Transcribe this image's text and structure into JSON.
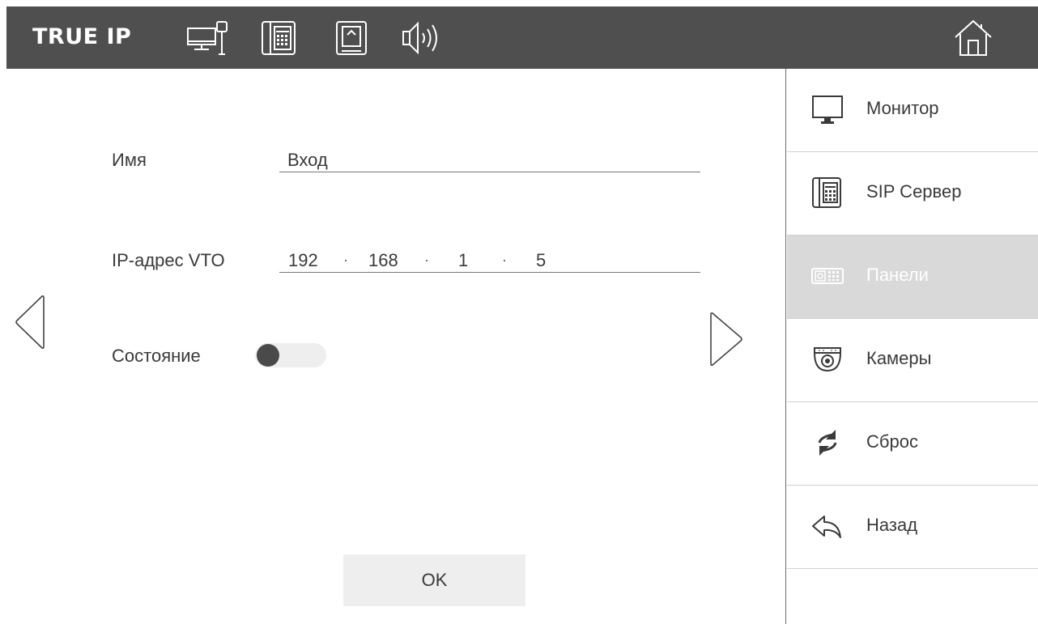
{
  "header": {
    "brand": "TRUE IP",
    "icons": [
      "network-monitor-icon",
      "sip-phone-icon",
      "sd-card-icon",
      "speaker-icon"
    ],
    "home_icon": "home-icon"
  },
  "form": {
    "name_label": "Имя",
    "name_value": "Вход",
    "ip_label": "IP-адрес VTO",
    "ip": {
      "octet1": "192",
      "octet2": "168",
      "octet3": "1",
      "octet4": "5",
      "separator": "·"
    },
    "status_label": "Состояние",
    "status_on": false,
    "ok_label": "OK"
  },
  "sidebar": {
    "items": [
      {
        "label": "Монитор",
        "icon": "monitor-icon"
      },
      {
        "label": "SIP Сервер",
        "icon": "sip-phone-icon"
      },
      {
        "label": "Панели",
        "icon": "door-panel-icon",
        "active": true
      },
      {
        "label": "Камеры",
        "icon": "dome-camera-icon"
      },
      {
        "label": "Сброс",
        "icon": "reset-arrows-icon"
      },
      {
        "label": "Назад",
        "icon": "back-arrow-icon"
      }
    ]
  },
  "colors": {
    "topbar": "#4f4f4f",
    "active_item": "#d9d9d9",
    "button_bg": "#eeeeee",
    "text": "#3a3a3a"
  }
}
